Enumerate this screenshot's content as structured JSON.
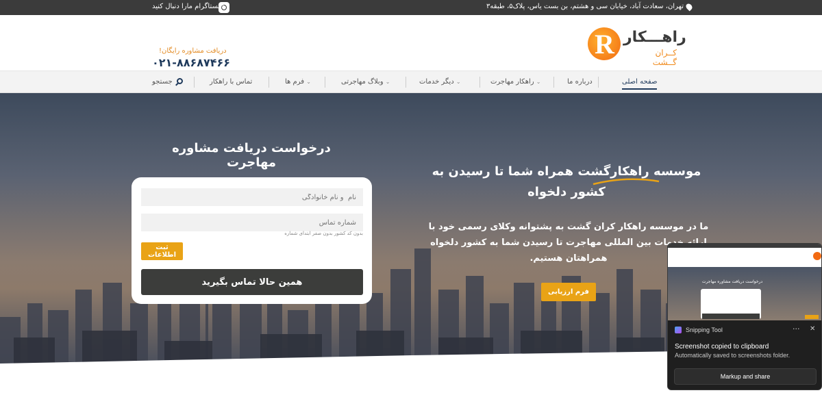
{
  "topbar": {
    "address": "تهران، سعادت آباد، خیابان سی و هشتم، بن بست یاس، پلاک۵، طبقه۳",
    "instagram": "اینستاگرام مارا دنبال کنید",
    "address_icon": "location-pin-icon",
    "instagram_icon": "instagram-icon"
  },
  "header": {
    "logo_name": "راهـــکار",
    "logo_sub": "کــران گــشت",
    "consult_label": "دریافت مشاوره رایگان!",
    "phone": "۰۲۱-۸۸۶۸۷۴۶۶"
  },
  "nav": {
    "items": [
      {
        "label": "صفحه اصلی",
        "active": true
      },
      {
        "label": "درباره ما"
      },
      {
        "label": "راهکار مهاجرت"
      },
      {
        "label": "دیگر خدمات"
      },
      {
        "label": "وبلاگ مهاجرتی"
      },
      {
        "label": "فرم ها"
      },
      {
        "label": "تماس با راهکار"
      }
    ],
    "search_label": "جستجو"
  },
  "form": {
    "title": "درخواست دریافت مشاوره مهاجرت",
    "name_placeholder": "نام  و نام خانوادگی",
    "phone_placeholder": "شماره تماس",
    "phone_hint": "بدون کد کشور بدون صفر ابتدای شماره",
    "submit": "ثبت اطلاعات",
    "call": "همین حالا تماس بگیرید"
  },
  "hero": {
    "heading": "موسسه راهکارگشت همراه شما تا رسیدن به کشور دلخواه",
    "text": "ما در موسسه راهکار کران گشت به پشتوانه وکلای رسمی خود با ارائه خدمات بین المللی مهاجرت تا رسیدن شما به کشور دلخواه همراهتان هستیم.",
    "button": "فرم ارزیابی"
  },
  "snipping": {
    "app": "Snipping Tool",
    "title": "Screenshot copied to clipboard",
    "desc": "Automatically saved to screenshots folder.",
    "button": "Markup and share",
    "more_icon": "···",
    "close_icon": "✕",
    "thumb_title": "درخواست دریافت مشاوره مهاجرت"
  },
  "colors": {
    "accent": "#e9a316",
    "dark": "#3b3b3b",
    "navy": "#1f3a5c"
  }
}
